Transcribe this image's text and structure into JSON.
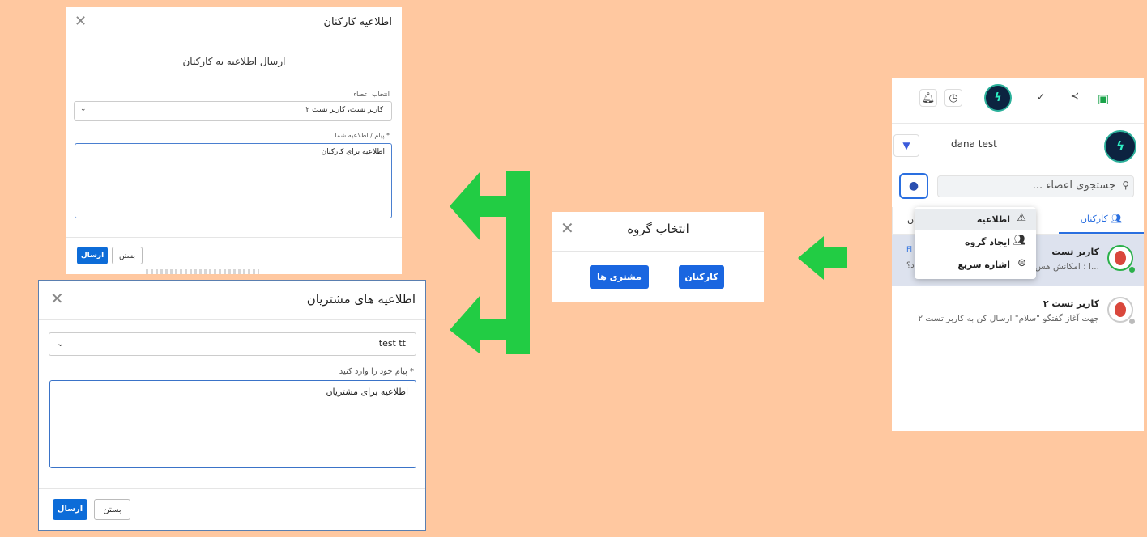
{
  "staff_modal": {
    "title": "اطلاعیه کارکنان",
    "subtitle": "ارسال اطلاعیه به کارکنان",
    "members_label": "انتخاب اعضاء",
    "members_value": "کاربر تست،  کاربر تست ۲",
    "message_label": "* پیام / اطلاعیه شما",
    "message_value": "اطلاعیه برای کارکنان",
    "send_label": "ارسال",
    "close_label": "بستن"
  },
  "customer_modal": {
    "title": "اطلاعیه های مشتریان",
    "select_value": "test tt",
    "message_label": "* پیام خود را وارد کنید",
    "message_value": "اطلاعیه برای مشتریان",
    "send_label": "ارسال",
    "close_label": "بستن"
  },
  "group_modal": {
    "title": "انتخاب گروه",
    "customers_button": "مشتری ها",
    "staff_button": "کارکنان"
  },
  "chat": {
    "user_name": "dana test",
    "search_placeholder": "جستجوی اعضاء ...",
    "tab_staff": "کارکنان",
    "tab_other_partial": "ن",
    "dropdown": [
      {
        "label": "اطلاعیه",
        "icon": "announcement-icon"
      },
      {
        "label": "ایجاد گروه",
        "icon": "add-group-icon"
      },
      {
        "label": "اشاره سریع",
        "icon": "quick-reply-icon"
      }
    ],
    "items": [
      {
        "name": "کاربر تست",
        "preview": "...ا : امکانش هس",
        "tag": "Fi",
        "trail": "د؟"
      },
      {
        "name": "کاربر تست ۲",
        "preview": "جهت آغاز گفتگو \"سلام\" ارسال کن به کاربر تست ۲"
      }
    ]
  },
  "colors": {
    "background": "#ffc8a0",
    "accent": "#0d6cd8",
    "arrow": "#22cc44",
    "online": "#2bb04a"
  }
}
